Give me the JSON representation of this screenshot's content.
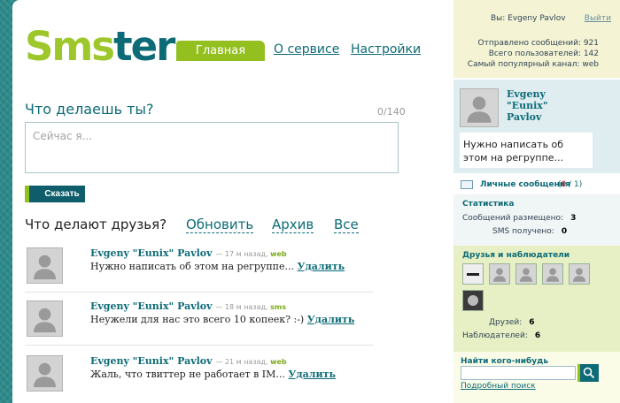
{
  "logo": {
    "part1": "Sms",
    "part2": "ter"
  },
  "nav": {
    "home": "Главная",
    "about": "О сервисе",
    "settings": "Настройки"
  },
  "compose": {
    "question": "Что делаешь ты?",
    "counter": "0/140",
    "placeholder": "Сейчас я...",
    "submit": "Сказать"
  },
  "friends_feed": {
    "title": "Что делают друзья?",
    "refresh": "Обновить",
    "archive": "Архив",
    "all": "Все"
  },
  "feed": [
    {
      "author": "Evgeny \"Eunix\" Pavlov",
      "meta": "— 17 м назад,",
      "source": "web",
      "message": "Нужно написать об этом на регруппе...",
      "delete": "Удалить"
    },
    {
      "author": "Evgeny \"Eunix\" Pavlov",
      "meta": "— 18 м назад,",
      "source": "sms",
      "message": "Неужели для нас это всего 10 копеек? :-)",
      "delete": "Удалить"
    },
    {
      "author": "Evgeny \"Eunix\" Pavlov",
      "meta": "— 21 м назад,",
      "source": "web",
      "message": "Жаль, что твиттер не работает в IM...",
      "delete": "Удалить"
    }
  ],
  "sidebar": {
    "user_line": "Вы: Evgeny Pavlov",
    "logout": "Выйти",
    "sent_line": "Отправлено сообщений: 921",
    "users_line": "Всего пользователей: 142",
    "channel_line": "Самый популярный канал: web",
    "profile_name": "Evgeny \"Eunix\" Pavlov",
    "profile_status": "Нужно написать об этом на регруппе...",
    "pm_label": "Личные сообщения",
    "pm_paren_open": "(",
    "pm_unread": "0",
    "pm_total": " / 1)",
    "stats_title": "Статистика",
    "posted_label": "Сообщений размещено:",
    "posted_value": "3",
    "sms_label": "SMS получено:",
    "sms_value": "0",
    "friends_title": "Друзья и наблюдатели",
    "friends_label": "Друзей:",
    "friends_value": "6",
    "followers_label": "Наблюдателей:",
    "followers_value": "6",
    "search_title": "Найти кого-нибудь",
    "advanced_search": "Подробный поиск"
  },
  "colors": {
    "brand_green": "#93c01f",
    "brand_teal": "#0d6b77",
    "background": "#2d8a8a"
  },
  "icons": [
    "search-icon",
    "envelope-icon",
    "user-silhouette-icon"
  ]
}
